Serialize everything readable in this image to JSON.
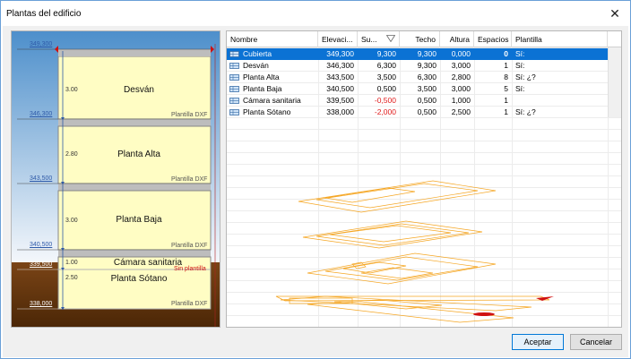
{
  "window": {
    "title": "Plantas del edificio",
    "close_glyph": "✕"
  },
  "section": {
    "levels": [
      {
        "value": "349,300"
      },
      {
        "value": "346,300"
      },
      {
        "value": "343,500"
      },
      {
        "value": "340,500"
      },
      {
        "value": "339,500"
      },
      {
        "value": "338,000"
      }
    ],
    "floors": [
      {
        "name": "Desván",
        "height": "3.00",
        "template": "Plantilla DXF"
      },
      {
        "name": "Planta Alta",
        "height": "2.80",
        "template": "Plantilla DXF"
      },
      {
        "name": "Planta Baja",
        "height": "3.00",
        "template": "Plantilla DXF"
      },
      {
        "name": "Cámara sanitaria",
        "height": "1.00",
        "template": "Sin plantilla"
      },
      {
        "name": "Planta Sótano",
        "height": "2.50",
        "template": "Plantilla DXF"
      }
    ]
  },
  "grid": {
    "columns": [
      "Nombre",
      "Elevaci...",
      "Su...",
      "Techo",
      "Altura",
      "Espacios",
      "Plantilla"
    ],
    "rows": [
      {
        "name": "Cubierta",
        "elev": "349,300",
        "su": "9,300",
        "techo": "9,300",
        "altura": "0,000",
        "espacios": "0",
        "plantilla": "Sí:",
        "selected": true,
        "neg": false
      },
      {
        "name": "Desván",
        "elev": "346,300",
        "su": "6,300",
        "techo": "9,300",
        "altura": "3,000",
        "espacios": "1",
        "plantilla": "Sí:",
        "selected": false,
        "neg": false
      },
      {
        "name": "Planta Alta",
        "elev": "343,500",
        "su": "3,500",
        "techo": "6,300",
        "altura": "2,800",
        "espacios": "8",
        "plantilla": "Sí: ¿?",
        "selected": false,
        "neg": false
      },
      {
        "name": "Planta Baja",
        "elev": "340,500",
        "su": "0,500",
        "techo": "3,500",
        "altura": "3,000",
        "espacios": "5",
        "plantilla": "Sí:",
        "selected": false,
        "neg": false
      },
      {
        "name": "Cámara sanitaria",
        "elev": "339,500",
        "su": "-0,500",
        "techo": "0,500",
        "altura": "1,000",
        "espacios": "1",
        "plantilla": "",
        "selected": false,
        "neg": true
      },
      {
        "name": "Planta Sótano",
        "elev": "338,000",
        "su": "-2,000",
        "techo": "0,500",
        "altura": "2,500",
        "espacios": "1",
        "plantilla": "Sí: ¿?",
        "selected": false,
        "neg": true
      }
    ]
  },
  "buttons": {
    "accept": "Aceptar",
    "cancel": "Cancelar"
  },
  "colors": {
    "accent": "#0b72d4",
    "floor_fill": "#fffdc4",
    "sky_top": "#5e9bd0",
    "ground": "#6b3a12",
    "dxf_lines": "#f5a623",
    "negative": "#e01a1a"
  },
  "icons": {
    "row_icon": "floor-plan-icon",
    "sort_icon": "sort-filter-icon",
    "marker_icon": "red-flag-icon"
  }
}
